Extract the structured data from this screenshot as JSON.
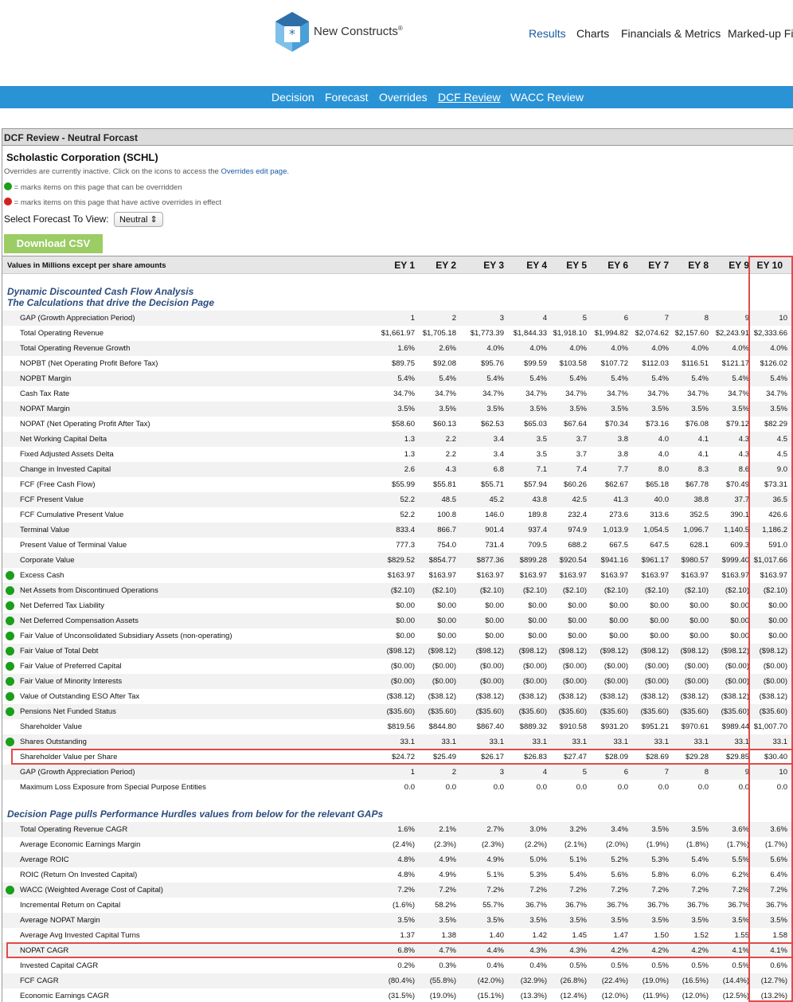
{
  "header": {
    "brand": "New Constructs",
    "nav": [
      "Results",
      "Charts",
      "Financials & Metrics",
      "Marked-up Fili"
    ]
  },
  "subnav": [
    "Decision",
    "Forecast",
    "Overrides",
    "DCF Review",
    "WACC Review"
  ],
  "panel_title": "DCF Review - Neutral Forcast",
  "company": "Scholastic Corporation (SCHL)",
  "notes": {
    "inactive_prefix": "Overrides are currently inactive. Click on the icons to access the",
    "inactive_link": "Overrides edit page",
    "inactive_suffix": ".",
    "green": "= marks items on this page that can be overridden",
    "red": "= marks items on this page that have active overrides in effect"
  },
  "select": {
    "label": "Select Forecast To View:",
    "value": "Neutral ⇕"
  },
  "csv_button": "Download CSV",
  "table_header": "Values in Millions except per share amounts",
  "years": [
    "EY 1",
    "EY 2",
    "EY 3",
    "EY 4",
    "EY 5",
    "EY 6",
    "EY 7",
    "EY 8",
    "EY 9",
    "EY 10"
  ],
  "sections": {
    "s1_line1": "Dynamic Discounted Cash Flow Analysis",
    "s1_line2": "The Calculations that drive the Decision Page",
    "s2": "Decision Page pulls Performance Hurdles values from below for the relevant GAPs"
  },
  "rows1": [
    {
      "label": "GAP (Growth Appreciation Period)",
      "dot": false,
      "v": [
        "1",
        "2",
        "3",
        "4",
        "5",
        "6",
        "7",
        "8",
        "9",
        "10"
      ]
    },
    {
      "label": "Total Operating Revenue",
      "dot": false,
      "v": [
        "$1,661.97",
        "$1,705.18",
        "$1,773.39",
        "$1,844.33",
        "$1,918.10",
        "$1,994.82",
        "$2,074.62",
        "$2,157.60",
        "$2,243.91",
        "$2,333.66"
      ]
    },
    {
      "label": "Total Operating Revenue Growth",
      "dot": false,
      "v": [
        "1.6%",
        "2.6%",
        "4.0%",
        "4.0%",
        "4.0%",
        "4.0%",
        "4.0%",
        "4.0%",
        "4.0%",
        "4.0%"
      ]
    },
    {
      "label": "NOPBT (Net Operating Profit Before Tax)",
      "dot": false,
      "v": [
        "$89.75",
        "$92.08",
        "$95.76",
        "$99.59",
        "$103.58",
        "$107.72",
        "$112.03",
        "$116.51",
        "$121.17",
        "$126.02"
      ]
    },
    {
      "label": "NOPBT Margin",
      "dot": false,
      "v": [
        "5.4%",
        "5.4%",
        "5.4%",
        "5.4%",
        "5.4%",
        "5.4%",
        "5.4%",
        "5.4%",
        "5.4%",
        "5.4%"
      ]
    },
    {
      "label": "Cash Tax Rate",
      "dot": false,
      "v": [
        "34.7%",
        "34.7%",
        "34.7%",
        "34.7%",
        "34.7%",
        "34.7%",
        "34.7%",
        "34.7%",
        "34.7%",
        "34.7%"
      ]
    },
    {
      "label": "NOPAT Margin",
      "dot": false,
      "v": [
        "3.5%",
        "3.5%",
        "3.5%",
        "3.5%",
        "3.5%",
        "3.5%",
        "3.5%",
        "3.5%",
        "3.5%",
        "3.5%"
      ]
    },
    {
      "label": "NOPAT (Net Operating Profit After Tax)",
      "dot": false,
      "v": [
        "$58.60",
        "$60.13",
        "$62.53",
        "$65.03",
        "$67.64",
        "$70.34",
        "$73.16",
        "$76.08",
        "$79.12",
        "$82.29"
      ]
    },
    {
      "label": "Net Working Capital Delta",
      "dot": false,
      "v": [
        "1.3",
        "2.2",
        "3.4",
        "3.5",
        "3.7",
        "3.8",
        "4.0",
        "4.1",
        "4.3",
        "4.5"
      ]
    },
    {
      "label": "Fixed Adjusted Assets Delta",
      "dot": false,
      "v": [
        "1.3",
        "2.2",
        "3.4",
        "3.5",
        "3.7",
        "3.8",
        "4.0",
        "4.1",
        "4.3",
        "4.5"
      ]
    },
    {
      "label": "Change in Invested Capital",
      "dot": false,
      "v": [
        "2.6",
        "4.3",
        "6.8",
        "7.1",
        "7.4",
        "7.7",
        "8.0",
        "8.3",
        "8.6",
        "9.0"
      ]
    },
    {
      "label": "FCF (Free Cash Flow)",
      "dot": false,
      "v": [
        "$55.99",
        "$55.81",
        "$55.71",
        "$57.94",
        "$60.26",
        "$62.67",
        "$65.18",
        "$67.78",
        "$70.49",
        "$73.31"
      ]
    },
    {
      "label": "FCF Present Value",
      "dot": false,
      "v": [
        "52.2",
        "48.5",
        "45.2",
        "43.8",
        "42.5",
        "41.3",
        "40.0",
        "38.8",
        "37.7",
        "36.5"
      ]
    },
    {
      "label": "FCF Cumulative Present Value",
      "dot": false,
      "v": [
        "52.2",
        "100.8",
        "146.0",
        "189.8",
        "232.4",
        "273.6",
        "313.6",
        "352.5",
        "390.1",
        "426.6"
      ]
    },
    {
      "label": "Terminal Value",
      "dot": false,
      "v": [
        "833.4",
        "866.7",
        "901.4",
        "937.4",
        "974.9",
        "1,013.9",
        "1,054.5",
        "1,096.7",
        "1,140.5",
        "1,186.2"
      ]
    },
    {
      "label": "Present Value of Terminal Value",
      "dot": false,
      "v": [
        "777.3",
        "754.0",
        "731.4",
        "709.5",
        "688.2",
        "667.5",
        "647.5",
        "628.1",
        "609.3",
        "591.0"
      ]
    },
    {
      "label": "Corporate Value",
      "dot": false,
      "v": [
        "$829.52",
        "$854.77",
        "$877.36",
        "$899.28",
        "$920.54",
        "$941.16",
        "$961.17",
        "$980.57",
        "$999.40",
        "$1,017.66"
      ]
    },
    {
      "label": "Excess Cash",
      "dot": true,
      "v": [
        "$163.97",
        "$163.97",
        "$163.97",
        "$163.97",
        "$163.97",
        "$163.97",
        "$163.97",
        "$163.97",
        "$163.97",
        "$163.97"
      ]
    },
    {
      "label": "Net Assets from Discontinued Operations",
      "dot": true,
      "v": [
        "($2.10)",
        "($2.10)",
        "($2.10)",
        "($2.10)",
        "($2.10)",
        "($2.10)",
        "($2.10)",
        "($2.10)",
        "($2.10)",
        "($2.10)"
      ]
    },
    {
      "label": "Net Deferred Tax Liability",
      "dot": true,
      "v": [
        "$0.00",
        "$0.00",
        "$0.00",
        "$0.00",
        "$0.00",
        "$0.00",
        "$0.00",
        "$0.00",
        "$0.00",
        "$0.00"
      ]
    },
    {
      "label": "Net Deferred Compensation Assets",
      "dot": true,
      "v": [
        "$0.00",
        "$0.00",
        "$0.00",
        "$0.00",
        "$0.00",
        "$0.00",
        "$0.00",
        "$0.00",
        "$0.00",
        "$0.00"
      ]
    },
    {
      "label": "Fair Value of Unconsolidated Subsidiary Assets (non-operating)",
      "dot": true,
      "v": [
        "$0.00",
        "$0.00",
        "$0.00",
        "$0.00",
        "$0.00",
        "$0.00",
        "$0.00",
        "$0.00",
        "$0.00",
        "$0.00"
      ]
    },
    {
      "label": "Fair Value of Total Debt",
      "dot": true,
      "v": [
        "($98.12)",
        "($98.12)",
        "($98.12)",
        "($98.12)",
        "($98.12)",
        "($98.12)",
        "($98.12)",
        "($98.12)",
        "($98.12)",
        "($98.12)"
      ]
    },
    {
      "label": "Fair Value of Preferred Capital",
      "dot": true,
      "v": [
        "($0.00)",
        "($0.00)",
        "($0.00)",
        "($0.00)",
        "($0.00)",
        "($0.00)",
        "($0.00)",
        "($0.00)",
        "($0.00)",
        "($0.00)"
      ]
    },
    {
      "label": "Fair Value of Minority Interests",
      "dot": true,
      "v": [
        "($0.00)",
        "($0.00)",
        "($0.00)",
        "($0.00)",
        "($0.00)",
        "($0.00)",
        "($0.00)",
        "($0.00)",
        "($0.00)",
        "($0.00)"
      ]
    },
    {
      "label": "Value of Outstanding ESO After Tax",
      "dot": true,
      "v": [
        "($38.12)",
        "($38.12)",
        "($38.12)",
        "($38.12)",
        "($38.12)",
        "($38.12)",
        "($38.12)",
        "($38.12)",
        "($38.12)",
        "($38.12)"
      ]
    },
    {
      "label": "Pensions Net Funded Status",
      "dot": true,
      "v": [
        "($35.60)",
        "($35.60)",
        "($35.60)",
        "($35.60)",
        "($35.60)",
        "($35.60)",
        "($35.60)",
        "($35.60)",
        "($35.60)",
        "($35.60)"
      ]
    },
    {
      "label": "Shareholder Value",
      "dot": false,
      "v": [
        "$819.56",
        "$844.80",
        "$867.40",
        "$889.32",
        "$910.58",
        "$931.20",
        "$951.21",
        "$970.61",
        "$989.44",
        "$1,007.70"
      ]
    },
    {
      "label": "Shares Outstanding",
      "dot": true,
      "v": [
        "33.1",
        "33.1",
        "33.1",
        "33.1",
        "33.1",
        "33.1",
        "33.1",
        "33.1",
        "33.1",
        "33.1"
      ]
    },
    {
      "label": "Shareholder Value per Share",
      "dot": false,
      "v": [
        "$24.72",
        "$25.49",
        "$26.17",
        "$26.83",
        "$27.47",
        "$28.09",
        "$28.69",
        "$29.28",
        "$29.85",
        "$30.40"
      ]
    },
    {
      "label": "GAP (Growth Appreciation Period)",
      "dot": false,
      "v": [
        "1",
        "2",
        "3",
        "4",
        "5",
        "6",
        "7",
        "8",
        "9",
        "10"
      ]
    },
    {
      "label": "Maximum Loss Exposure from Special Purpose Entities",
      "dot": false,
      "v": [
        "0.0",
        "0.0",
        "0.0",
        "0.0",
        "0.0",
        "0.0",
        "0.0",
        "0.0",
        "0.0",
        "0.0"
      ]
    }
  ],
  "rows2": [
    {
      "label": "Total Operating Revenue CAGR",
      "dot": false,
      "v": [
        "1.6%",
        "2.1%",
        "2.7%",
        "3.0%",
        "3.2%",
        "3.4%",
        "3.5%",
        "3.5%",
        "3.6%",
        "3.6%"
      ]
    },
    {
      "label": "Average Economic Earnings Margin",
      "dot": false,
      "v": [
        "(2.4%)",
        "(2.3%)",
        "(2.3%)",
        "(2.2%)",
        "(2.1%)",
        "(2.0%)",
        "(1.9%)",
        "(1.8%)",
        "(1.7%)",
        "(1.7%)"
      ]
    },
    {
      "label": "Average ROIC",
      "dot": false,
      "v": [
        "4.8%",
        "4.9%",
        "4.9%",
        "5.0%",
        "5.1%",
        "5.2%",
        "5.3%",
        "5.4%",
        "5.5%",
        "5.6%"
      ]
    },
    {
      "label": "ROIC (Return On Invested Capital)",
      "dot": false,
      "v": [
        "4.8%",
        "4.9%",
        "5.1%",
        "5.3%",
        "5.4%",
        "5.6%",
        "5.8%",
        "6.0%",
        "6.2%",
        "6.4%"
      ]
    },
    {
      "label": "WACC (Weighted Average Cost of Capital)",
      "dot": true,
      "v": [
        "7.2%",
        "7.2%",
        "7.2%",
        "7.2%",
        "7.2%",
        "7.2%",
        "7.2%",
        "7.2%",
        "7.2%",
        "7.2%"
      ]
    },
    {
      "label": "Incremental Return on Capital",
      "dot": false,
      "v": [
        "(1.6%)",
        "58.2%",
        "55.7%",
        "36.7%",
        "36.7%",
        "36.7%",
        "36.7%",
        "36.7%",
        "36.7%",
        "36.7%"
      ]
    },
    {
      "label": "Average NOPAT Margin",
      "dot": false,
      "v": [
        "3.5%",
        "3.5%",
        "3.5%",
        "3.5%",
        "3.5%",
        "3.5%",
        "3.5%",
        "3.5%",
        "3.5%",
        "3.5%"
      ]
    },
    {
      "label": "Average Avg Invested Capital Turns",
      "dot": false,
      "v": [
        "1.37",
        "1.38",
        "1.40",
        "1.42",
        "1.45",
        "1.47",
        "1.50",
        "1.52",
        "1.55",
        "1.58"
      ]
    },
    {
      "label": "NOPAT CAGR",
      "dot": false,
      "v": [
        "6.8%",
        "4.7%",
        "4.4%",
        "4.3%",
        "4.3%",
        "4.2%",
        "4.2%",
        "4.2%",
        "4.1%",
        "4.1%"
      ]
    },
    {
      "label": "Invested Capital CAGR",
      "dot": false,
      "v": [
        "0.2%",
        "0.3%",
        "0.4%",
        "0.4%",
        "0.5%",
        "0.5%",
        "0.5%",
        "0.5%",
        "0.5%",
        "0.6%"
      ]
    },
    {
      "label": "FCF CAGR",
      "dot": false,
      "v": [
        "(80.4%)",
        "(55.8%)",
        "(42.0%)",
        "(32.9%)",
        "(26.8%)",
        "(22.4%)",
        "(19.0%)",
        "(16.5%)",
        "(14.4%)",
        "(12.7%)"
      ]
    },
    {
      "label": "Economic Earnings CAGR",
      "dot": false,
      "v": [
        "(31.5%)",
        "(19.0%)",
        "(15.1%)",
        "(13.3%)",
        "(12.4%)",
        "(12.0%)",
        "(11.9%)",
        "(12.0%)",
        "(12.5%)",
        "(13.2%)"
      ]
    }
  ]
}
